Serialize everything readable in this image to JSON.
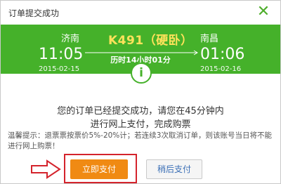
{
  "dialog": {
    "title": "订单提交成功",
    "close_glyph": "✕"
  },
  "train": {
    "from_station": "济南",
    "to_station": "南昌",
    "train_number": "K491（硬卧）",
    "depart_time": "11:05",
    "arrive_time": "01:06",
    "depart_date": "2015-02-15",
    "arrive_date": "2015-02-16",
    "duration": "历时14小时01分"
  },
  "info_icon_glyph": "i",
  "message": {
    "line1": "您的订单已经提交成功，请您在45分钟内",
    "line2": "进行网上支付，完成购票"
  },
  "tip": "温馨提示：退票票按票价5%-20%计；若连续3次取消订单，则该账号当日将不能进行网上购票！",
  "buttons": {
    "pay_now": "立即支付",
    "pay_later": "稍后支付"
  },
  "colors": {
    "banner": "#45b12a",
    "train_number": "#ffe25a",
    "pay_button": "#f08a13",
    "highlight": "#d4232c"
  }
}
